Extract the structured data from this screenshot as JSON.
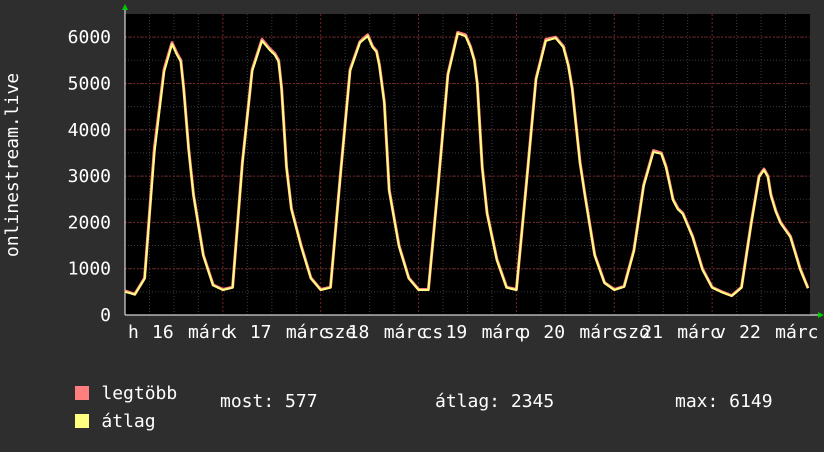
{
  "chart_data": {
    "type": "line",
    "ylabel": "onlinestream.live",
    "yticks": [
      0,
      1000,
      2000,
      3000,
      4000,
      5000,
      6000
    ],
    "ylim": [
      0,
      6500
    ],
    "xlim": [
      0,
      7
    ],
    "xtick_labels": [
      "h",
      "16",
      "márc",
      "k",
      "17",
      "márc",
      "sze",
      "18",
      "márc",
      "cs",
      "19",
      "márc",
      "p",
      "20",
      "márc",
      "szo",
      "21",
      "márc",
      "v",
      "22",
      "márc"
    ],
    "grid": true,
    "series": [
      {
        "name": "legtöbb",
        "color": "#ff7f7f",
        "x": [
          0.0,
          0.1,
          0.2,
          0.3,
          0.4,
          0.48,
          0.53,
          0.57,
          0.6,
          0.65,
          0.7,
          0.8,
          0.9,
          1.0,
          1.1,
          1.2,
          1.3,
          1.4,
          1.48,
          1.53,
          1.57,
          1.6,
          1.65,
          1.7,
          1.8,
          1.9,
          2.0,
          2.1,
          2.2,
          2.3,
          2.4,
          2.48,
          2.53,
          2.57,
          2.6,
          2.65,
          2.7,
          2.8,
          2.9,
          3.0,
          3.1,
          3.2,
          3.3,
          3.4,
          3.48,
          3.53,
          3.57,
          3.6,
          3.65,
          3.7,
          3.8,
          3.9,
          4.0,
          4.1,
          4.2,
          4.3,
          4.4,
          4.48,
          4.53,
          4.57,
          4.6,
          4.65,
          4.7,
          4.8,
          4.9,
          5.0,
          5.1,
          5.2,
          5.3,
          5.4,
          5.48,
          5.53,
          5.57,
          5.6,
          5.65,
          5.7,
          5.8,
          5.9,
          6.0,
          6.1,
          6.2,
          6.3,
          6.4,
          6.48,
          6.53,
          6.57,
          6.6,
          6.65,
          6.7,
          6.8,
          6.9,
          6.98
        ],
        "values": [
          520,
          450,
          800,
          3600,
          5300,
          5880,
          5650,
          5500,
          4900,
          3600,
          2600,
          1300,
          650,
          550,
          600,
          3300,
          5300,
          5950,
          5750,
          5650,
          5500,
          4900,
          3200,
          2300,
          1500,
          800,
          550,
          600,
          3000,
          5300,
          5900,
          6050,
          5800,
          5700,
          5400,
          4600,
          2700,
          1500,
          800,
          550,
          550,
          2800,
          5200,
          6100,
          6050,
          5800,
          5500,
          5000,
          3200,
          2200,
          1200,
          600,
          550,
          2800,
          5100,
          5950,
          6000,
          5800,
          5400,
          4900,
          4300,
          3300,
          2600,
          1300,
          700,
          550,
          620,
          1400,
          2800,
          3550,
          3500,
          3200,
          2800,
          2500,
          2300,
          2200,
          1700,
          1000,
          600,
          500,
          420,
          600,
          2000,
          3000,
          3150,
          3000,
          2600,
          2250,
          2000,
          1700,
          1000,
          580
        ]
      },
      {
        "name": "átlag",
        "color": "#ffff80",
        "x": [
          0.0,
          0.1,
          0.2,
          0.3,
          0.4,
          0.48,
          0.53,
          0.57,
          0.6,
          0.65,
          0.7,
          0.8,
          0.9,
          1.0,
          1.1,
          1.2,
          1.3,
          1.4,
          1.48,
          1.53,
          1.57,
          1.6,
          1.65,
          1.7,
          1.8,
          1.9,
          2.0,
          2.1,
          2.2,
          2.3,
          2.4,
          2.48,
          2.53,
          2.57,
          2.6,
          2.65,
          2.7,
          2.8,
          2.9,
          3.0,
          3.1,
          3.2,
          3.3,
          3.4,
          3.48,
          3.53,
          3.57,
          3.6,
          3.65,
          3.7,
          3.8,
          3.9,
          4.0,
          4.1,
          4.2,
          4.3,
          4.4,
          4.48,
          4.53,
          4.57,
          4.6,
          4.65,
          4.7,
          4.8,
          4.9,
          5.0,
          5.1,
          5.2,
          5.3,
          5.4,
          5.48,
          5.53,
          5.57,
          5.6,
          5.65,
          5.7,
          5.8,
          5.9,
          6.0,
          6.1,
          6.2,
          6.3,
          6.4,
          6.48,
          6.53,
          6.57,
          6.6,
          6.65,
          6.7,
          6.8,
          6.9,
          6.98
        ],
        "values": [
          500,
          440,
          780,
          3500,
          5250,
          5850,
          5620,
          5470,
          4880,
          3580,
          2580,
          1280,
          640,
          540,
          590,
          3280,
          5270,
          5920,
          5720,
          5620,
          5470,
          4880,
          3180,
          2280,
          1480,
          790,
          540,
          590,
          2980,
          5270,
          5880,
          6020,
          5780,
          5680,
          5380,
          4580,
          2680,
          1480,
          790,
          540,
          540,
          2780,
          5180,
          6080,
          6020,
          5780,
          5480,
          4980,
          3180,
          2180,
          1180,
          590,
          540,
          2780,
          5080,
          5920,
          5980,
          5780,
          5380,
          4880,
          4280,
          3280,
          2580,
          1280,
          690,
          540,
          610,
          1380,
          2780,
          3520,
          3480,
          3180,
          2780,
          2480,
          2280,
          2180,
          1680,
          980,
          590,
          490,
          410,
          590,
          1980,
          2980,
          3130,
          2980,
          2580,
          2230,
          1980,
          1680,
          980,
          577
        ]
      }
    ]
  },
  "legend": [
    {
      "label": "legtöbb",
      "color": "#ff7f7f"
    },
    {
      "label": "átlag",
      "color": "#ffff80"
    }
  ],
  "stats": {
    "most": "most: 577",
    "atlag": "átlag: 2345",
    "max": "max: 6149"
  }
}
